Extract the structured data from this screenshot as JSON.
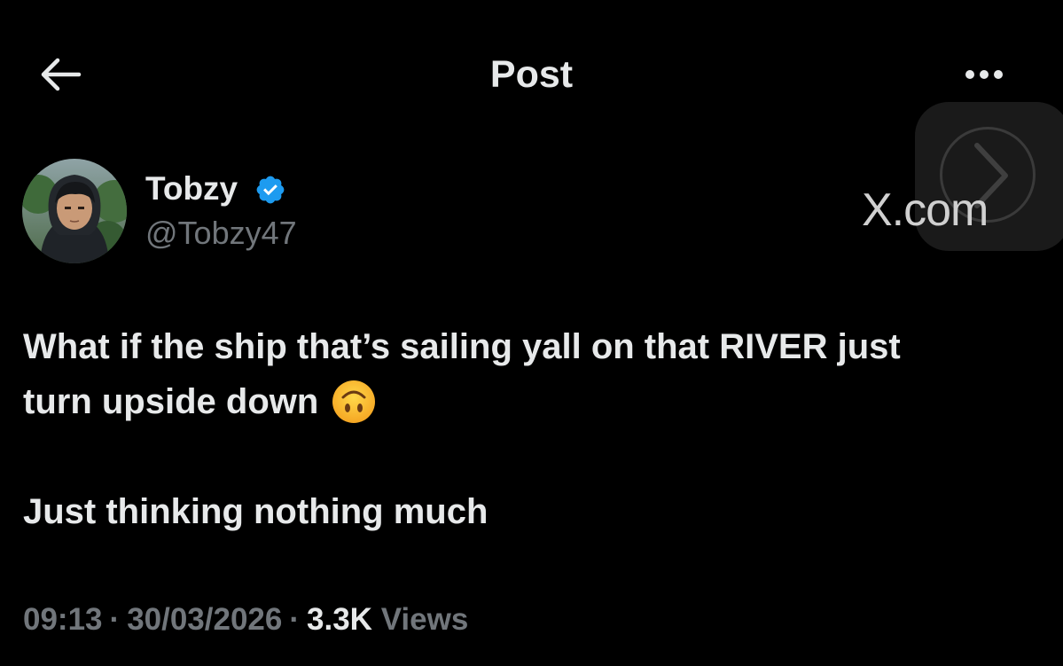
{
  "header": {
    "title": "Post",
    "back_icon": "arrow-left-icon",
    "more_icon": "more-horizontal-icon"
  },
  "watermark": {
    "text": "X.com",
    "icon": "chevron-right-icon"
  },
  "author": {
    "display_name": "Tobzy",
    "handle": "@Tobzy47",
    "verified": true,
    "verified_color": "#1d9bf0",
    "avatar_icon": "avatar"
  },
  "post": {
    "line1": "What if the ship that’s sailing yall on that RIVER  just",
    "line2": "turn upside down",
    "emoji": "upside-down-face-emoji",
    "paragraph2": "Just thinking nothing much"
  },
  "meta": {
    "time": "09:13",
    "separator": "·",
    "date": "30/03/2026",
    "views_count": "3.3K",
    "views_label": "Views"
  },
  "colors": {
    "background": "#000000",
    "primary_text": "#e7e9ea",
    "secondary_text": "#71767b",
    "accent": "#1d9bf0"
  }
}
